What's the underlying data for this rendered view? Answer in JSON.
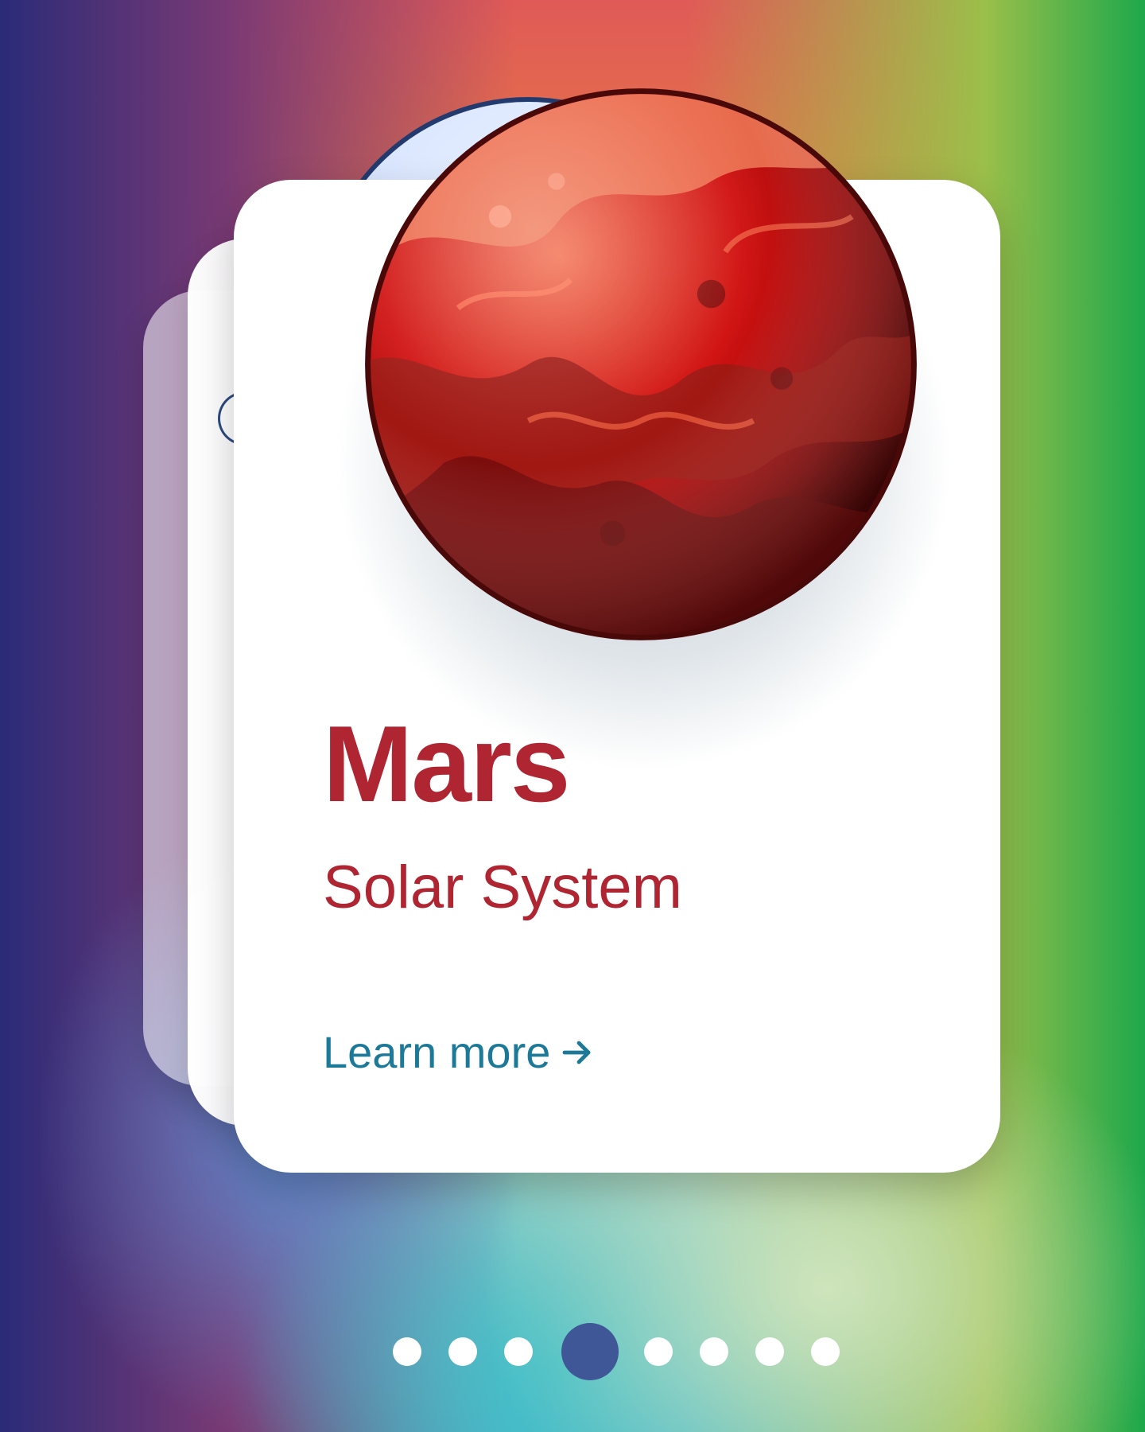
{
  "carousel": {
    "current_index": 3,
    "total": 8,
    "active_dot_color": "#3f5697",
    "inactive_dot_color": "#ffffff"
  },
  "card": {
    "title": "Mars",
    "subtitle": "Solar System",
    "link_label": "Learn more",
    "link_icon": "arrow-right-icon",
    "accent_color": "#b02532",
    "link_color": "#1c7a98"
  },
  "planet": {
    "image": "mars-planet-illustration",
    "colors": [
      "#d01010",
      "#a11712",
      "#7c0d0d",
      "#f26b4a"
    ]
  }
}
